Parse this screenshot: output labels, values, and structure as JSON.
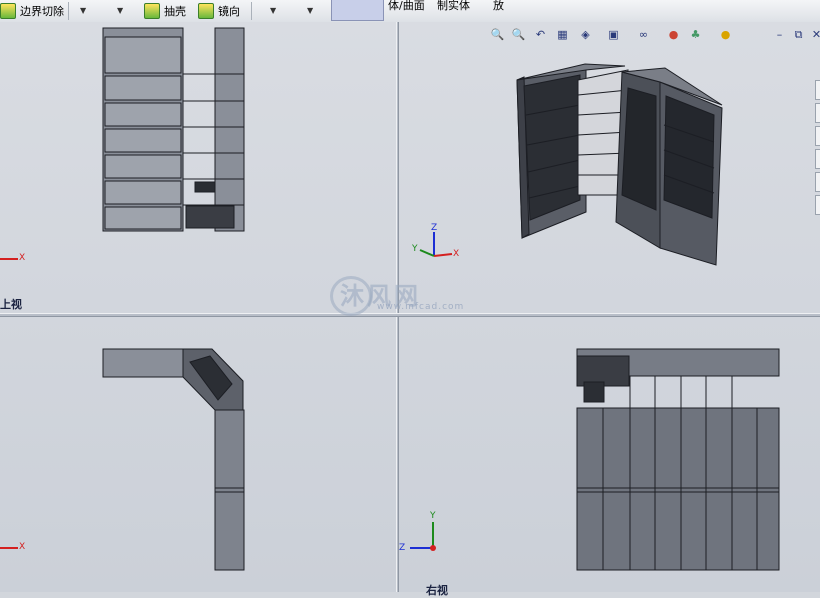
{
  "toolbar": {
    "boundary_cut_label": "边界切除",
    "shell_label": "抽壳",
    "mirror_label": "镜向",
    "surface_body_label": "体/曲面",
    "solid_label": "制实体",
    "place_label": "放"
  },
  "viewports": {
    "top_left_label": "上视",
    "bottom_right_label": "右视"
  },
  "axes": {
    "x": "X",
    "y": "Y",
    "z": "Z"
  },
  "view_controls": {
    "minimize": "–",
    "restore": "⧉",
    "close": "✕"
  },
  "watermark": {
    "brand": "沐风网",
    "url": "www.mfcad.com"
  },
  "colors": {
    "model": "#4a4e58",
    "model_edge": "#1c1e24",
    "viewport_bg": "#d2d6dc",
    "x_axis": "#d42020",
    "y_axis": "#1c8a1c",
    "z_axis": "#1c2ed4"
  }
}
